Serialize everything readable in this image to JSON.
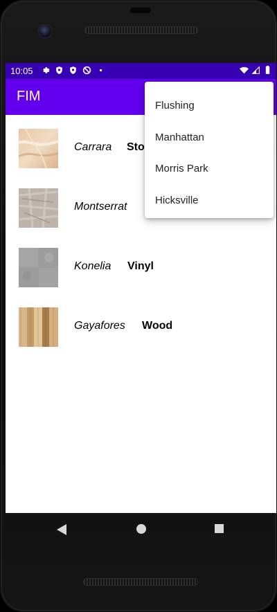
{
  "status_bar": {
    "time": "10:05",
    "left_icons": [
      "gear-icon",
      "shield-icon",
      "shield-icon",
      "no-sync-icon",
      "dot-icon"
    ],
    "right_icons": [
      "wifi-icon",
      "signal-icon",
      "battery-icon"
    ]
  },
  "app_bar": {
    "title": "FIM",
    "color": "#6200ee",
    "status_color": "#3700b3"
  },
  "items": [
    {
      "name": "Carrara",
      "type": "Stone",
      "texture": "marble-beige"
    },
    {
      "name": "Montserrat",
      "type": "",
      "texture": "stone-gray-beige"
    },
    {
      "name": "Konelia",
      "type": "Vinyl",
      "texture": "concrete-gray"
    },
    {
      "name": "Gayafores",
      "type": "Wood",
      "texture": "wood-planks"
    }
  ],
  "menu": {
    "items": [
      "Flushing",
      "Manhattan",
      "Morris Park",
      "Hicksville"
    ]
  },
  "nav_bar": {
    "icons": [
      "back-icon",
      "home-icon",
      "recents-icon"
    ]
  }
}
